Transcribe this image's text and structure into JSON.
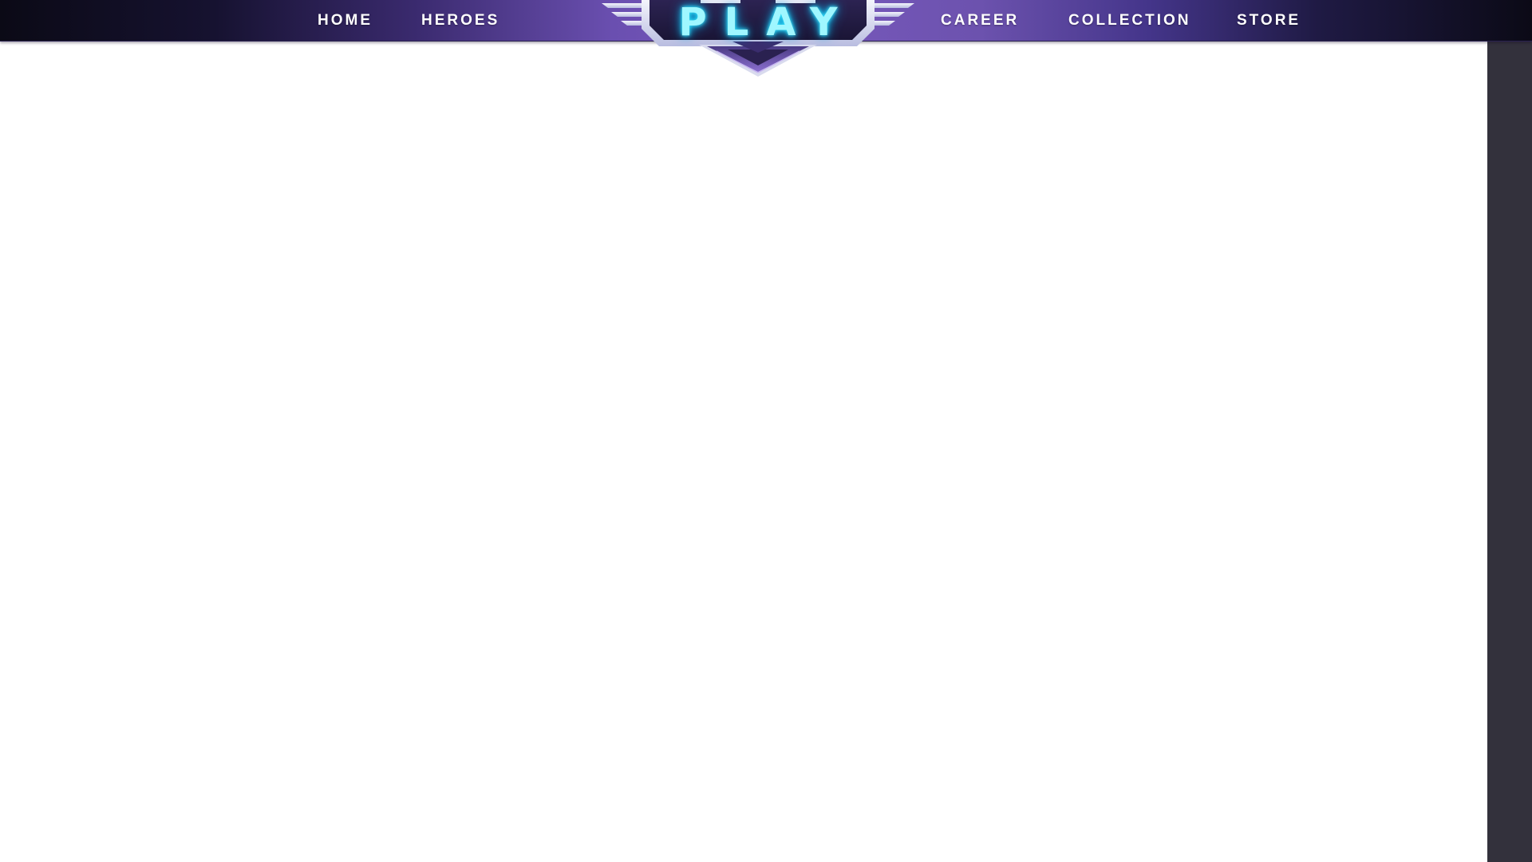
{
  "nav": {
    "items": [
      {
        "label": "HOME"
      },
      {
        "label": "HEROES"
      },
      {
        "label": "CAREER"
      },
      {
        "label": "COLLECTION"
      },
      {
        "label": "STORE"
      }
    ],
    "play_label": "PLAY"
  },
  "colors": {
    "nav_gradient_center": "#7656ba",
    "nav_gradient_edge": "#0b0a16",
    "play_glow": "#3ee8ff",
    "emblem_dark": "#231c44",
    "emblem_frame": "#e4e6f3",
    "right_panel": "#33313c"
  }
}
